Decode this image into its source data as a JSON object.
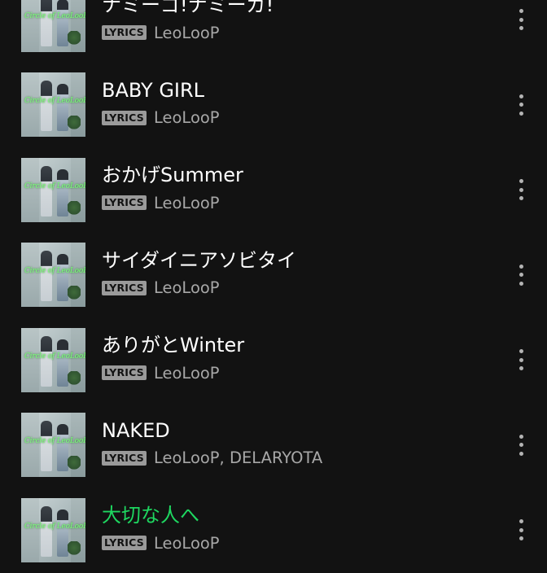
{
  "tracks": [
    {
      "title": "ナミーゴ!ナミーガ!",
      "badge": "LYRICS",
      "artist": "LeoLooP",
      "cover_text": "Circle of LeoLooP",
      "active": false
    },
    {
      "title": "BABY GIRL",
      "badge": "LYRICS",
      "artist": "LeoLooP",
      "cover_text": "Circle of LeoLooP",
      "active": false
    },
    {
      "title": "おかげSummer",
      "badge": "LYRICS",
      "artist": "LeoLooP",
      "cover_text": "Circle of LeoLooP",
      "active": false
    },
    {
      "title": "サイダイニアソビタイ",
      "badge": "LYRICS",
      "artist": "LeoLooP",
      "cover_text": "Circle of LeoLooP",
      "active": false
    },
    {
      "title": "ありがとWinter",
      "badge": "LYRICS",
      "artist": "LeoLooP",
      "cover_text": "Circle of LeoLooP",
      "active": false
    },
    {
      "title": "NAKED",
      "badge": "LYRICS",
      "artist": "LeoLooP, DELARYOTA",
      "cover_text": "Circle of LeoLooP",
      "active": false
    },
    {
      "title": "大切な人へ",
      "badge": "LYRICS",
      "artist": "LeoLooP",
      "cover_text": "Circle of LeoLooP",
      "active": true
    }
  ],
  "icons": {
    "more": "more-vertical-icon"
  },
  "colors": {
    "background": "#121212",
    "title": "#ffffff",
    "active_title": "#1ed760",
    "artist": "#a7a7a7",
    "badge_bg": "#9a9a9a",
    "badge_text": "#121212",
    "cover_title": "#7dff7a"
  }
}
